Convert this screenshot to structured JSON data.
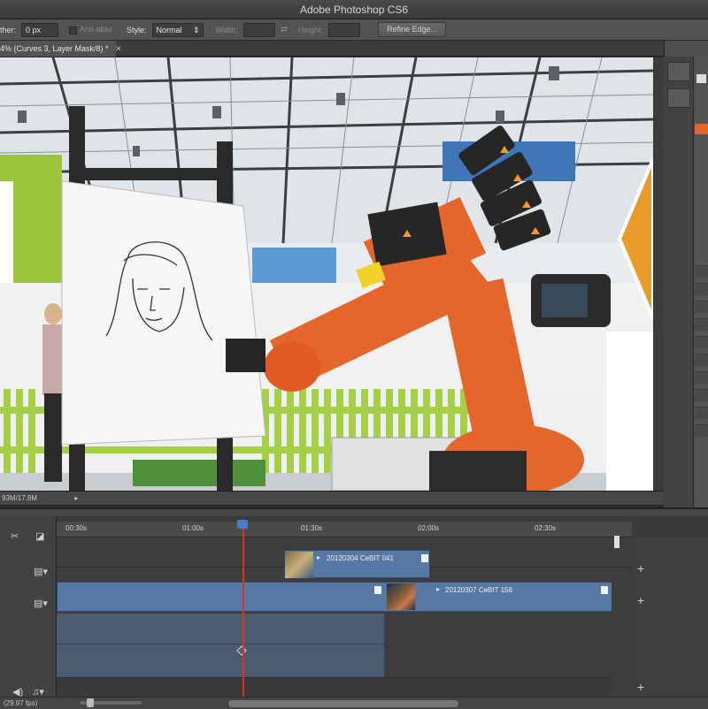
{
  "app": {
    "title": "Adobe Photoshop CS6"
  },
  "options_bar": {
    "feather_label": "ther:",
    "feather_value": "0 px",
    "antialias_label": "Anti-alias",
    "style_label": "Style:",
    "style_value": "Normal",
    "width_label": "Width:",
    "height_label": "Height:",
    "refine_edge_label": "Refine Edge..."
  },
  "document": {
    "tab_title": "4% (Curves 3, Layer Mask/8) *",
    "status_text": "93M/17.8M"
  },
  "timeline": {
    "ruler_ticks": [
      "00:30s",
      "01:00s",
      "01:30s",
      "02:00s",
      "02:30s"
    ],
    "clips": [
      {
        "label": "20120304 CeBIT 041"
      },
      {
        "label": "20120307 CeBIT 156"
      }
    ],
    "frame_rate": "(29.97 fps)"
  },
  "colors": {
    "accent_orange": "#e4662a",
    "clip_blue": "#5678a3",
    "playhead_red": "#d8322a"
  },
  "icons": [
    "scissors-icon",
    "transition-icon",
    "film-icon",
    "audio-icon",
    "speaker-icon",
    "plus-icon",
    "close-icon"
  ]
}
